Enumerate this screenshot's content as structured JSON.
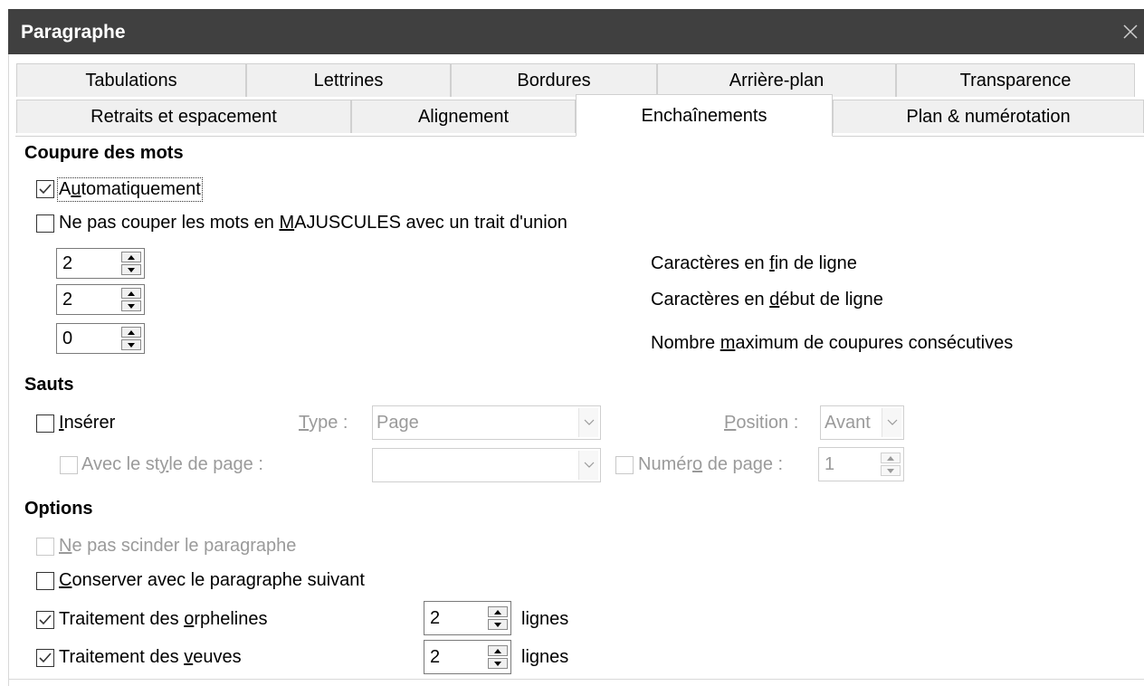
{
  "window": {
    "title": "Paragraphe"
  },
  "tabs_row1": [
    "Tabulations",
    "Lettrines",
    "Bordures",
    "Arrière-plan",
    "Transparence"
  ],
  "tabs_row2": [
    "Retraits et espacement",
    "Alignement",
    "Enchaînements",
    "Plan & numérotation"
  ],
  "active_tab": "Enchaînements",
  "hyphenation": {
    "heading": "Coupure des mots",
    "auto_label": "Automatiquement",
    "auto_checked": true,
    "caps_label": "Ne pas couper les mots en MAJUSCULES avec un trait d'union",
    "caps_checked": false,
    "end_chars": {
      "value": "2",
      "label": "Caractères en fin de ligne"
    },
    "begin_chars": {
      "value": "2",
      "label": "Caractères en début de ligne"
    },
    "max_hyphens": {
      "value": "0",
      "label": "Nombre maximum de coupures consécutives"
    }
  },
  "breaks": {
    "heading": "Sauts",
    "insert_label": "Insérer",
    "insert_checked": false,
    "type_label": "Type :",
    "type_value": "Page",
    "position_label": "Position :",
    "position_value": "Avant",
    "page_style_label": "Avec le style de page :",
    "page_style_value": "",
    "page_number_label": "Numéro de page :",
    "page_number_value": "1"
  },
  "options": {
    "heading": "Options",
    "no_split_label": "Ne pas scinder le paragraphe",
    "keep_next_label": "Conserver avec le paragraphe suivant",
    "orphans_label": "Traitement des orphelines",
    "orphans_checked": true,
    "orphans_value": "2",
    "widows_label": "Traitement des veuves",
    "widows_checked": true,
    "widows_value": "2",
    "lines_unit": "lignes"
  },
  "icons": {
    "close": "close-icon",
    "check": "check-icon",
    "dropdown": "chevron-down-icon"
  }
}
